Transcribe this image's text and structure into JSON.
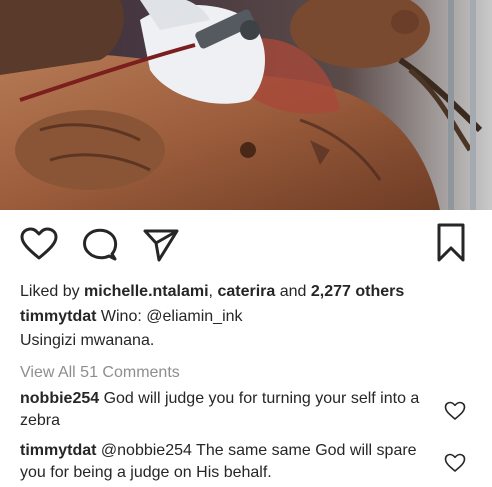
{
  "post": {
    "likes": {
      "prefix": "Liked by ",
      "user1": "michelle.ntalami",
      "separator": ", ",
      "user2": "caterira",
      "and": " and ",
      "others": "2,277 others"
    },
    "caption": {
      "username": "timmytdat",
      "text_prefix": " Wino: ",
      "mention": "@eliamin_ink",
      "second_line": "Usingizi mwanana."
    },
    "view_all_comments": "View All 51 Comments",
    "comments": [
      {
        "username": "nobbie254",
        "text": " God will judge you for turning your self into a zebra"
      },
      {
        "username": "timmytdat",
        "mention": " @nobbie254",
        "text": " The same same God will spare you for being a judge on His behalf."
      }
    ]
  },
  "icons": {
    "like": "heart-icon",
    "comment": "comment-bubble-icon",
    "share": "send-arrow-icon",
    "save": "bookmark-icon",
    "comment_like": "heart-outline-icon"
  },
  "colors": {
    "text": "#262626",
    "muted": "#8e8e8e",
    "icon": "#262626"
  }
}
